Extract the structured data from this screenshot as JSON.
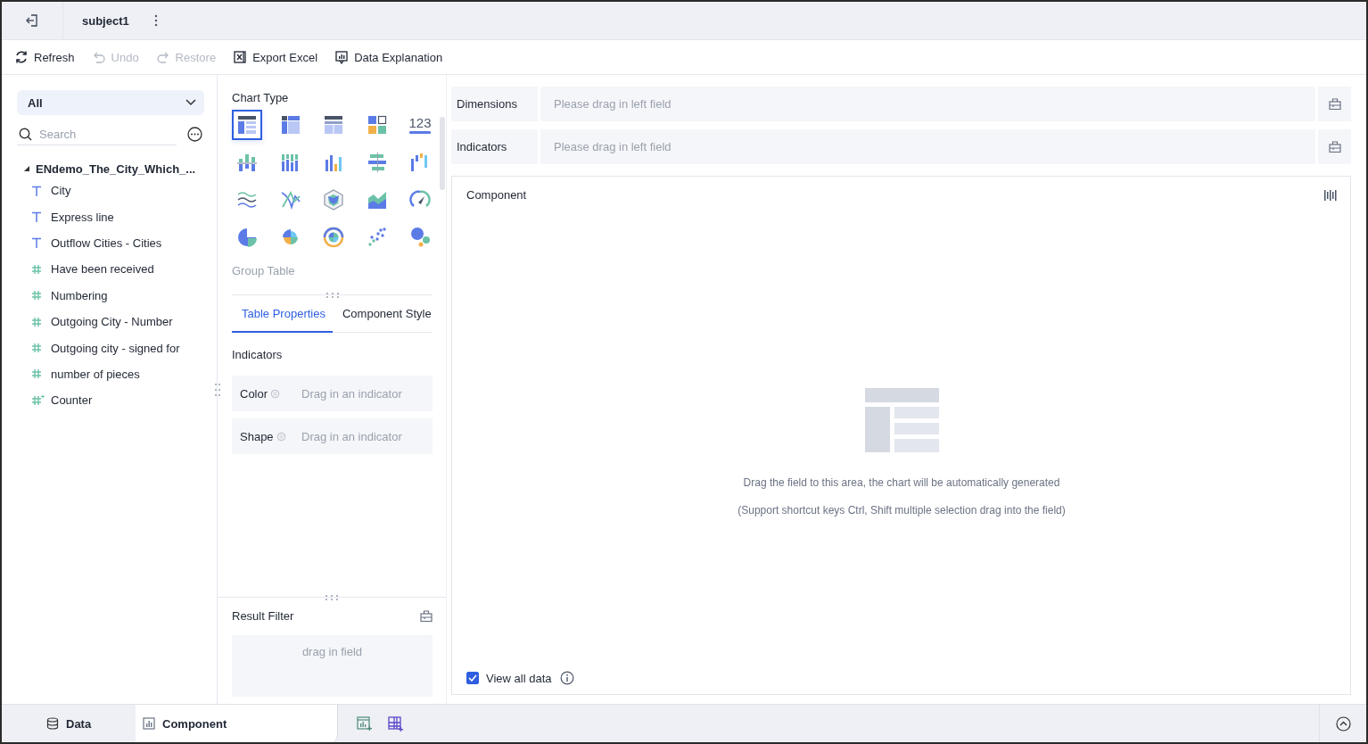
{
  "topbar": {
    "title": "subject1"
  },
  "toolbar": [
    {
      "kind": "refresh",
      "label": "Refresh",
      "disabled": false
    },
    {
      "kind": "undo",
      "label": "Undo",
      "disabled": true
    },
    {
      "kind": "restore",
      "label": "Restore",
      "disabled": true
    },
    {
      "kind": "excel",
      "label": "Export Excel",
      "disabled": false
    },
    {
      "kind": "explain",
      "label": "Data Explanation",
      "disabled": false
    }
  ],
  "field_panel": {
    "filter": "All",
    "search": {
      "placeholder": "Search"
    },
    "dataset": {
      "name": "ENdemo_The_City_Which_...",
      "expanded": true,
      "fields": [
        {
          "kind": "text",
          "name": "City"
        },
        {
          "kind": "text",
          "name": "Express line"
        },
        {
          "kind": "text",
          "name": "Outflow Cities - Cities"
        },
        {
          "kind": "number",
          "name": "Have been received"
        },
        {
          "kind": "number",
          "name": "Numbering"
        },
        {
          "kind": "number",
          "name": "Outgoing City - Number"
        },
        {
          "kind": "number",
          "name": "Outgoing city - signed for"
        },
        {
          "kind": "number",
          "name": "number of pieces"
        },
        {
          "kind": "calculated",
          "name": "Counter"
        }
      ]
    }
  },
  "chart_panel": {
    "title": "Chart Type",
    "chart_types": [
      {
        "kind": "table",
        "selected": true
      },
      {
        "kind": "cross-table",
        "selected": false
      },
      {
        "kind": "detail-table",
        "selected": false
      },
      {
        "kind": "block",
        "selected": false
      },
      {
        "kind": "number",
        "glyph": "123",
        "selected": false
      },
      {
        "kind": "stacked-bar",
        "selected": false
      },
      {
        "kind": "multi-bar",
        "selected": false
      },
      {
        "kind": "bar",
        "selected": false
      },
      {
        "kind": "bidirectional-bar",
        "selected": false
      },
      {
        "kind": "waterfall",
        "selected": false
      },
      {
        "kind": "line",
        "selected": false
      },
      {
        "kind": "crossing-line",
        "selected": false
      },
      {
        "kind": "radar",
        "selected": false
      },
      {
        "kind": "area",
        "selected": false
      },
      {
        "kind": "gauge",
        "selected": false
      },
      {
        "kind": "pie",
        "selected": false
      },
      {
        "kind": "rose",
        "selected": false
      },
      {
        "kind": "sunburst",
        "selected": false
      },
      {
        "kind": "scatter",
        "selected": false
      },
      {
        "kind": "bubble",
        "selected": false
      }
    ],
    "selected_name": "Group Table",
    "tabs": [
      {
        "label": "Table Properties",
        "selected": true
      },
      {
        "label": "Component Style",
        "selected": false
      }
    ],
    "section": "Indicators",
    "slots": [
      {
        "label": "Color",
        "prompt": "Drag in an indicator"
      },
      {
        "label": "Shape",
        "prompt": "Drag in an indicator"
      }
    ],
    "result_filter": {
      "title": "Result Filter",
      "prompt": "drag in field"
    }
  },
  "canvas": {
    "shelves": [
      {
        "label": "Dimensions",
        "prompt": "Please drag in left field"
      },
      {
        "label": "Indicators",
        "prompt": "Please drag in left field"
      }
    ],
    "component": {
      "title": "Component",
      "hint": "Drag the field to this area, the chart will be automatically generated",
      "subhint": "(Support shortcut keys Ctrl, Shift multiple selection drag into the field)",
      "view_all": {
        "label": "View all data",
        "checked": true
      }
    }
  },
  "bottom_tabs": [
    {
      "kind": "data",
      "label": "Data",
      "selected": false
    },
    {
      "kind": "component",
      "label": "Component",
      "selected": true
    }
  ]
}
